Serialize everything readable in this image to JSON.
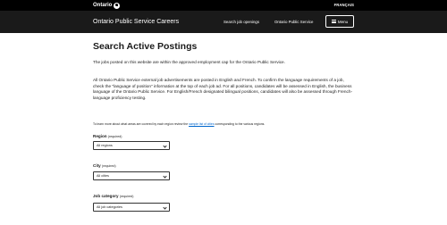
{
  "topbar": {
    "logo_text": "Ontario",
    "language_toggle": "FRANÇAIS"
  },
  "header": {
    "site_title": "Ontario Public Service Careers",
    "nav": {
      "search_jobs": "Search job openings",
      "ops": "Ontario Public Service"
    },
    "menu_label": "Menu"
  },
  "main": {
    "title": "Search Active Postings",
    "intro": "The jobs posted on this website are within the approved employment cap for the Ontario Public Service.",
    "language_notice": "All Ontario Public Service external job advertisements are posted in English and French. To confirm the language requirements of a job, check the \"language of position\" information at the top of each job ad. For all positions, candidates will be assessed in English, the business language of the Ontario Public Service. For English/French designated bilingual positions, candidates will also be assessed through French-language proficiency testing.",
    "region_note": {
      "before": "To learn more about what areas are covered by each region review the ",
      "link": "sample list of cities",
      "after": " corresponding to the various regions."
    }
  },
  "form": {
    "region": {
      "label": "Region",
      "required": "(required)",
      "value": "All regions"
    },
    "city": {
      "label": "City",
      "required": "(required)",
      "value": "All cities"
    },
    "job_category": {
      "label": "Job category",
      "required": "(required)",
      "value": "All job categories"
    }
  },
  "colors": {
    "topbar": "#000000",
    "header": "#1a1a1a",
    "link": "#0066cc"
  }
}
